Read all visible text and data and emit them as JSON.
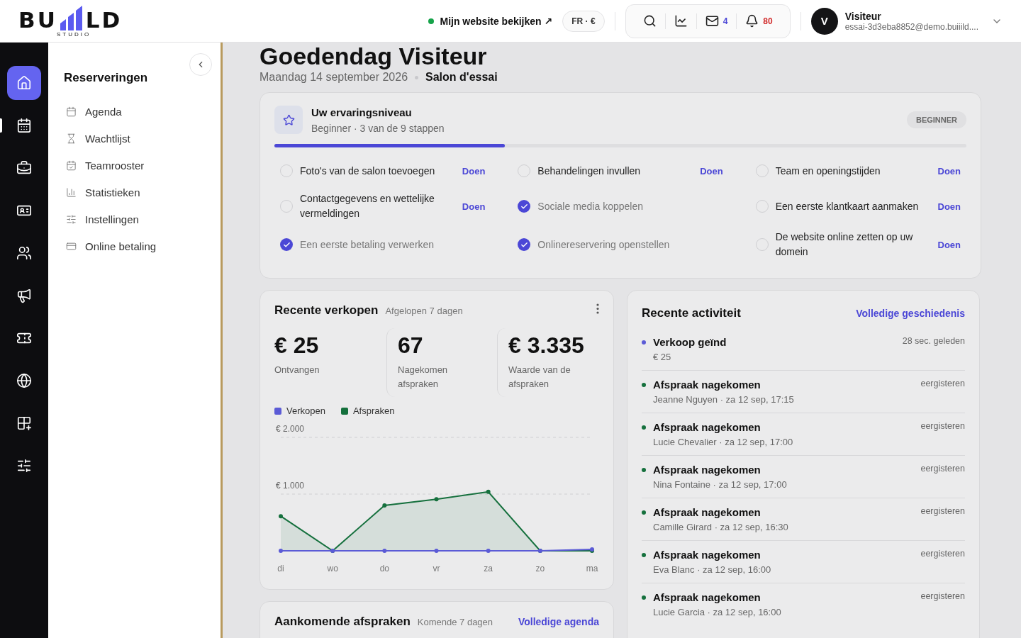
{
  "header": {
    "logo": {
      "left": "BU",
      "right": "LD",
      "tagline": "STUDIO"
    },
    "site_link": {
      "label": "Mijn website bekijken ↗",
      "online": true
    },
    "locale": {
      "language": "FR",
      "separator": "·",
      "currency": "€"
    },
    "toolbar": {
      "messages": "4",
      "notifications": "80"
    },
    "user": {
      "initial": "V",
      "name": "Visiteur",
      "email": "essai-3d3eba8852@demo.buiiild...."
    }
  },
  "rail": [
    {
      "selected": true,
      "current": false
    },
    {
      "selected": false,
      "current": true
    },
    {
      "selected": false,
      "current": false
    },
    {
      "selected": false,
      "current": false
    },
    {
      "selected": false,
      "current": false
    },
    {
      "selected": false,
      "current": false
    },
    {
      "selected": false,
      "current": false
    },
    {
      "selected": false,
      "current": false
    },
    {
      "selected": false,
      "current": false
    },
    {
      "selected": false,
      "current": false
    }
  ],
  "sidebar": {
    "title": "Reserveringen",
    "items": [
      {
        "label": "Agenda"
      },
      {
        "label": "Wachtlijst"
      },
      {
        "label": "Teamrooster"
      },
      {
        "label": "Statistieken"
      },
      {
        "label": "Instellingen"
      },
      {
        "label": "Online betaling"
      }
    ]
  },
  "page": {
    "greeting": "Goedendag Visiteur",
    "date": "Maandag 14 september 2026",
    "salon": "Salon d'essai"
  },
  "experience": {
    "title": "Uw ervaringsniveau",
    "subtitle": "Beginner · 3 van de 9 stappen",
    "badge": "BEGINNER",
    "level": 0.333,
    "steps": [
      {
        "label": "Foto's van de salon toevoegen",
        "done": false,
        "action": "Doen"
      },
      {
        "label": "Behandelingen invullen",
        "done": false,
        "action": "Doen"
      },
      {
        "label": "Team en openingstijden",
        "done": false,
        "action": "Doen"
      },
      {
        "label": "Contactgegevens en wettelijke vermeldingen",
        "done": false,
        "action": "Doen"
      },
      {
        "label": "Sociale media koppelen",
        "done": true
      },
      {
        "label": "Een eerste klantkaart aanmaken",
        "done": false,
        "action": "Doen"
      },
      {
        "label": "Een eerste betaling verwerken",
        "done": true
      },
      {
        "label": "Onlinereservering openstellen",
        "done": true
      },
      {
        "label": "De website online zetten op uw domein",
        "done": false,
        "action": "Doen"
      }
    ]
  },
  "sales": {
    "title": "Recente verkopen",
    "period": "Afgelopen 7 dagen",
    "stats": [
      {
        "value": "€ 25",
        "label": "Ontvangen"
      },
      {
        "value": "67",
        "label": "Nagekomen afspraken"
      },
      {
        "value": "€ 3.335",
        "label": "Waarde van de afspraken"
      }
    ],
    "chart_data": {
      "type": "area",
      "categories": [
        "di",
        "wo",
        "do",
        "vr",
        "za",
        "zo",
        "ma"
      ],
      "series": [
        {
          "name": "Verkopen",
          "color": "#5b5bd6",
          "values": [
            0,
            0,
            0,
            0,
            0,
            0,
            25
          ]
        },
        {
          "name": "Afspraken",
          "color": "#15703d",
          "values": [
            610,
            0,
            800,
            910,
            1040,
            0,
            0
          ]
        }
      ],
      "ylim": [
        0,
        2000
      ],
      "yticks": [
        {
          "value": 1000,
          "label": "€ 1.000"
        },
        {
          "value": 2000,
          "label": "€ 2.000"
        }
      ],
      "stacked": false
    }
  },
  "upcoming": {
    "title": "Aankomende afspraken",
    "period": "Komende 7 dagen",
    "link": "Volledige agenda"
  },
  "activity": {
    "title": "Recente activiteit",
    "link": "Volledige geschiedenis",
    "items": [
      {
        "title": "Verkoop geïnd",
        "detail": "€ 25",
        "time": "28 sec. geleden",
        "color": "#5b5bd6"
      },
      {
        "title": "Afspraak nagekomen",
        "detail": "Jeanne Nguyen · za 12 sep, 17:15",
        "time": "eergisteren",
        "color": "#15703d"
      },
      {
        "title": "Afspraak nagekomen",
        "detail": "Lucie Chevalier · za 12 sep, 17:00",
        "time": "eergisteren",
        "color": "#15703d"
      },
      {
        "title": "Afspraak nagekomen",
        "detail": "Nina Fontaine · za 12 sep, 17:00",
        "time": "eergisteren",
        "color": "#15703d"
      },
      {
        "title": "Afspraak nagekomen",
        "detail": "Camille Girard · za 12 sep, 16:30",
        "time": "eergisteren",
        "color": "#15703d"
      },
      {
        "title": "Afspraak nagekomen",
        "detail": "Eva Blanc · za 12 sep, 16:00",
        "time": "eergisteren",
        "color": "#15703d"
      },
      {
        "title": "Afspraak nagekomen",
        "detail": "Lucie Garcia · za 12 sep, 16:00",
        "time": "eergisteren",
        "color": "#15703d"
      }
    ]
  }
}
